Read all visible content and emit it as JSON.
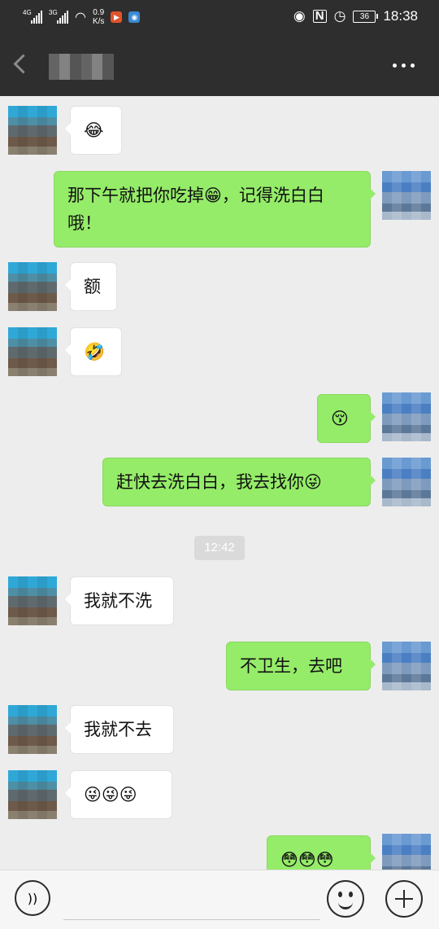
{
  "status_bar": {
    "network_1": "4G",
    "network_2": "3G",
    "speed_value": "0.9",
    "speed_unit": "K/s",
    "battery": "36",
    "time": "18:38"
  },
  "title_bar": {
    "contact_name": "•••"
  },
  "messages": [
    {
      "side": "left",
      "text": "😂"
    },
    {
      "side": "right",
      "text": "那下午就把你吃掉😁，记得洗白白哦！"
    },
    {
      "side": "left",
      "text": "额"
    },
    {
      "side": "left",
      "text": "🤣"
    },
    {
      "side": "right",
      "text": "😚"
    },
    {
      "side": "right",
      "text": "赶快去洗白白，我去找你😜"
    },
    {
      "side": "left",
      "text": "我就不洗"
    },
    {
      "side": "right",
      "text": "不卫生，去吧"
    },
    {
      "side": "left",
      "text": "我就不去"
    },
    {
      "side": "left",
      "text": "😜😜😜"
    },
    {
      "side": "right",
      "text": "😳😳😳"
    }
  ],
  "timestamp": "12:42",
  "colors": {
    "header_bg": "#2e2e2e",
    "chat_bg": "#ededed",
    "bubble_self": "#95ec69",
    "bubble_other": "#ffffff"
  }
}
